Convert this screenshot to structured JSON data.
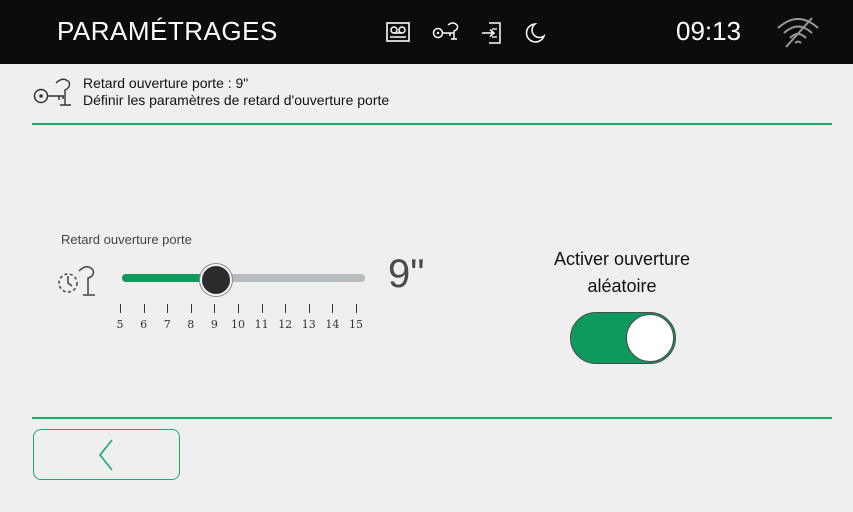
{
  "topbar": {
    "title": "PARAMÉTRAGES",
    "time": "09:13",
    "icons": [
      "voicemail-icon",
      "key-icon",
      "door-exit-icon",
      "moon-icon",
      "wifi-off-icon"
    ]
  },
  "header": {
    "icon": "key-icon",
    "line1": "Retard ouverture porte : 9\"",
    "line2": "Définir les paramètres de retard d'ouverture porte"
  },
  "slider": {
    "label": "Retard ouverture porte",
    "icon": "delay-key-icon",
    "min": 5,
    "max": 15,
    "value": 9,
    "value_display": "9\"",
    "ticks": [
      "5",
      "6",
      "7",
      "8",
      "9",
      "10",
      "11",
      "12",
      "13",
      "14",
      "15"
    ]
  },
  "random_open": {
    "label_line1": "Activer ouverture",
    "label_line2": "aléatoire",
    "enabled": true
  },
  "footer": {
    "back_icon": "chevron-left-icon"
  },
  "colors": {
    "accent": "#1aaa6a",
    "toggle_on": "#0d9a5c",
    "topbar": "#0c0c0c",
    "background": "#efefef"
  }
}
